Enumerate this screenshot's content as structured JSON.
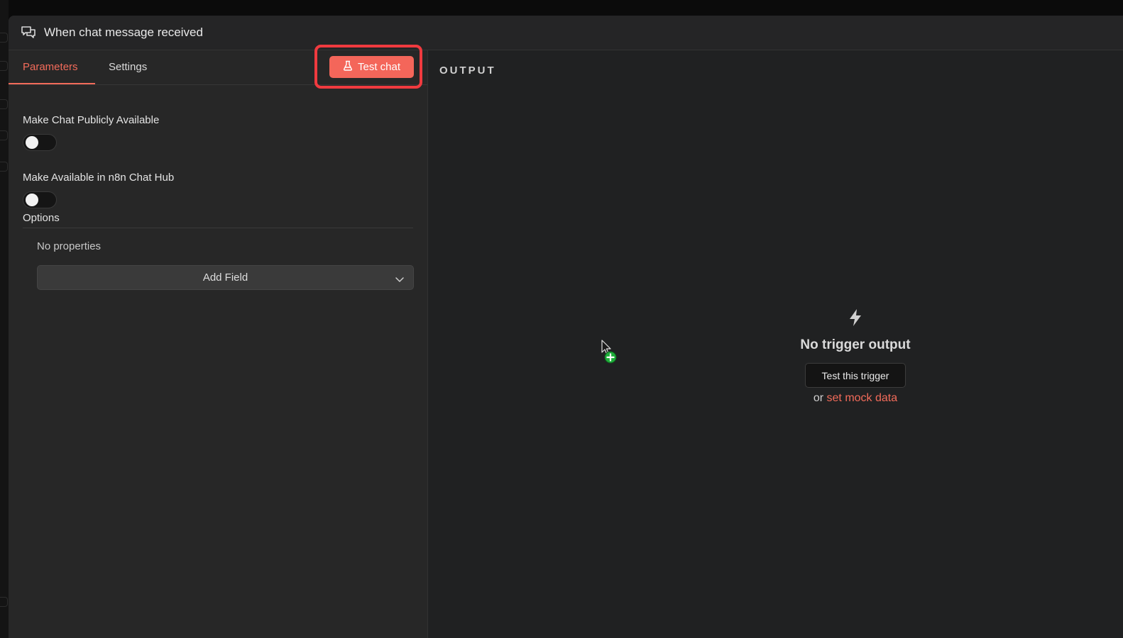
{
  "modal": {
    "title": "When chat message received",
    "title_icon": "chat-bubbles-icon"
  },
  "tabs": [
    {
      "label": "Parameters",
      "active": true
    },
    {
      "label": "Settings",
      "active": false
    }
  ],
  "test_chat_button": {
    "label": "Test chat",
    "icon": "flask-icon",
    "color": "#f4665a",
    "highlight_color": "#f03a3f"
  },
  "parameters": {
    "public_toggle": {
      "label": "Make Chat Publicly Available",
      "enabled": false
    },
    "hub_toggle": {
      "label": "Make Available in n8n Chat Hub",
      "enabled": false
    },
    "options": {
      "label": "Options",
      "empty_text": "No properties",
      "add_field_label": "Add Field"
    }
  },
  "output": {
    "label": "OUTPUT",
    "icon": "lightning-bolt-icon",
    "empty_title": "No trigger output",
    "test_trigger_label": "Test this trigger",
    "or_text": "or",
    "mock_link": "set mock data"
  },
  "colors": {
    "accent": "#f26b5a",
    "background": "#202122",
    "panel": "#272727"
  }
}
